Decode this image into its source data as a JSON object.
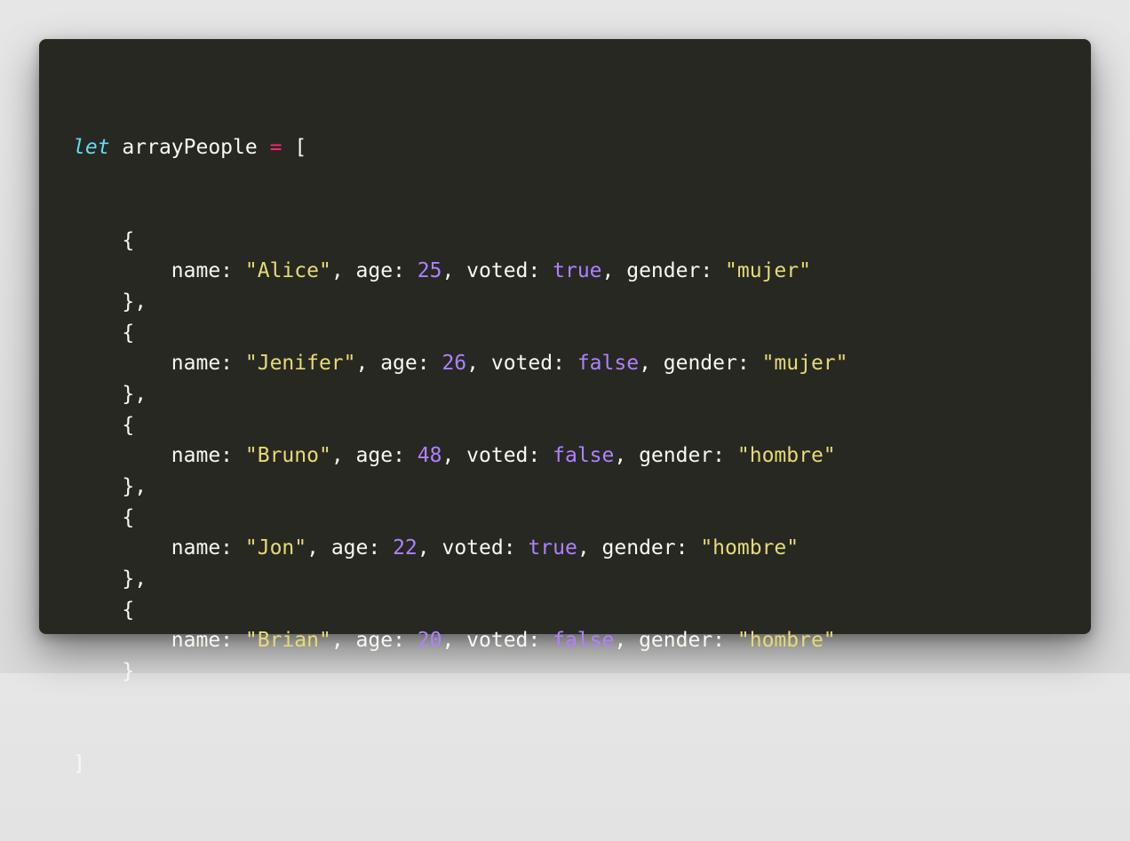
{
  "code": {
    "keyword": "let",
    "variable": "arrayPeople",
    "assign": "=",
    "open_bracket": "[",
    "close_bracket": "]",
    "open_brace": "{",
    "close_brace": "}",
    "close_brace_comma": "},",
    "keys": {
      "name": "name",
      "age": "age",
      "voted": "voted",
      "gender": "gender"
    },
    "people": [
      {
        "name": "\"Alice\"",
        "age": "25",
        "voted": "true",
        "gender": "\"mujer\""
      },
      {
        "name": "\"Jenifer\"",
        "age": "26",
        "voted": "false",
        "gender": "\"mujer\""
      },
      {
        "name": "\"Bruno\"",
        "age": "48",
        "voted": "false",
        "gender": "\"hombre\""
      },
      {
        "name": "\"Jon\"",
        "age": "22",
        "voted": "true",
        "gender": "\"hombre\""
      },
      {
        "name": "\"Brian\"",
        "age": "20",
        "voted": "false",
        "gender": "\"hombre\""
      }
    ]
  },
  "colors": {
    "background": "#272822",
    "keyword": "#66d9ef",
    "operator": "#f92672",
    "string": "#e6db74",
    "number": "#ae81ff",
    "text": "#f8f8f2"
  }
}
